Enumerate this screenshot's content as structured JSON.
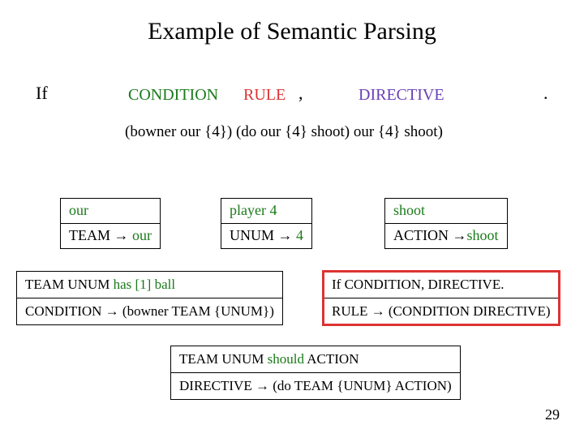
{
  "title": "Example of Semantic Parsing",
  "row1": {
    "if": "If",
    "condition": "CONDITION",
    "rule": "RULE",
    "comma": ",",
    "directive": "DIRECTIVE",
    "period": "."
  },
  "row2": "(bowner our {4}) (do our {4} shoot) our {4} shoot)",
  "triples": [
    {
      "top": "our",
      "bot_left": "TEAM",
      "bot_right": "our"
    },
    {
      "top": "player 4",
      "bot_left": "UNUM",
      "bot_right": "4"
    },
    {
      "top": "shoot",
      "bot_left": "ACTION",
      "bot_right": "shoot"
    }
  ],
  "pairs": [
    {
      "top_pre": "TEAM UNUM ",
      "top_green": "has [1] ball",
      "bot": "CONDITION → (bowner TEAM {UNUM})"
    },
    {
      "top": "If CONDITION, DIRECTIVE.",
      "bot": "RULE → (CONDITION DIRECTIVE)"
    },
    {
      "top_pre": "TEAM UNUM ",
      "top_green": "should",
      "top_post": " ACTION",
      "bot": "DIRECTIVE → (do TEAM {UNUM} ACTION)"
    }
  ],
  "slide_num": "29"
}
